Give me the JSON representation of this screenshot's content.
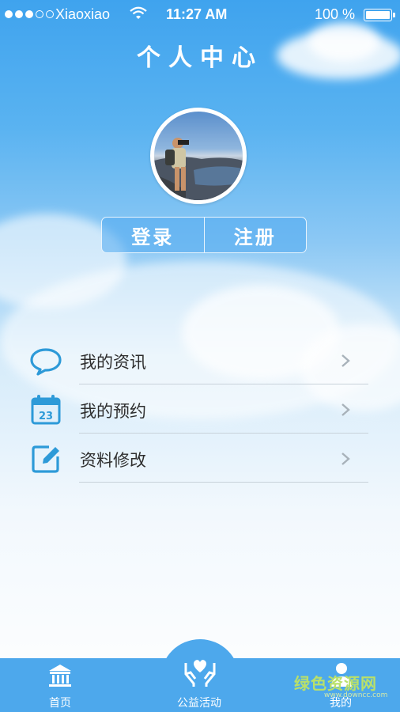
{
  "status_bar": {
    "carrier": "Xiaoxiao",
    "time": "11:27 AM",
    "battery": "100 %"
  },
  "header": {
    "title": "个人中心"
  },
  "auth": {
    "login_label": "登录",
    "register_label": "注册"
  },
  "menu": {
    "items": [
      {
        "label": "我的资讯",
        "icon": "chat-bubble-icon"
      },
      {
        "label": "我的预约",
        "icon": "calendar-icon",
        "badge": "23"
      },
      {
        "label": "资料修改",
        "icon": "edit-icon"
      }
    ]
  },
  "tabbar": {
    "items": [
      {
        "label": "首页",
        "icon": "bank-icon"
      },
      {
        "label": "公益活动",
        "icon": "hands-heart-icon"
      },
      {
        "label": "我的",
        "icon": "user-icon"
      }
    ]
  },
  "watermark": {
    "text": "绿色资源网",
    "sub": "www.downcc.com"
  },
  "colors": {
    "accent": "#4da8ec",
    "icon": "#2d9ad8"
  }
}
